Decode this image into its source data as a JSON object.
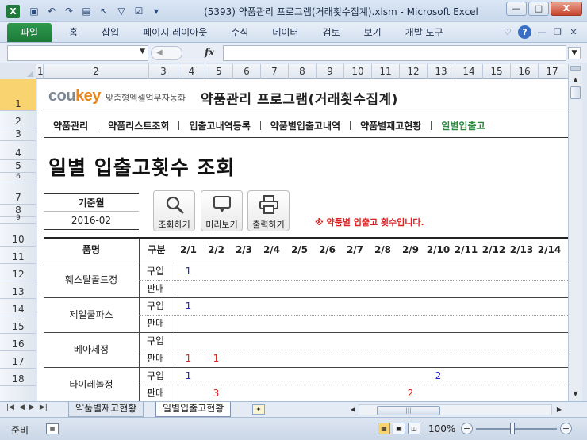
{
  "window": {
    "title": "(5393) 약품관리 프로그램(거래횟수집계).xlsm  -  Microsoft Excel",
    "app_icon": "X",
    "min_label": "—",
    "max_label": "□",
    "close_label": "X"
  },
  "ribbon": {
    "file_tab": "파일",
    "tabs": [
      "홈",
      "삽입",
      "페이지 레이아웃",
      "수식",
      "데이터",
      "검토",
      "보기",
      "개발 도구"
    ]
  },
  "formula_bar": {
    "name_box": "",
    "fx": "fx",
    "formula": ""
  },
  "columns": [
    "1",
    "2",
    "3",
    "4",
    "5",
    "6",
    "7",
    "8",
    "9",
    "10",
    "11",
    "12",
    "13",
    "14",
    "15",
    "16",
    "17"
  ],
  "rows": [
    "1",
    "2",
    "3",
    "4",
    "5",
    "6",
    "7",
    "8",
    "9",
    "10",
    "11",
    "12",
    "13",
    "14",
    "15",
    "16",
    "17",
    "18"
  ],
  "sheet": {
    "brand_logo_main": "cou",
    "brand_logo_accent": "key",
    "brand_tagline": "맞춤형엑셀업무자동화",
    "program_title": "약품관리 프로그램(거래횟수집계)",
    "menu": [
      "약품관리",
      "약품리스트조회",
      "입출고내역등록",
      "약품별입출고내역",
      "약품별재고현황",
      "일별입출고"
    ],
    "page_heading": "일별 입출고횟수 조회",
    "basis_label": "기준월",
    "basis_value": "2016-02",
    "buttons": {
      "search": "조회하기",
      "preview": "미리보기",
      "print": "출력하기"
    },
    "notice": "※ 약품별 입출고 횟수입니다.",
    "table": {
      "header_item": "품명",
      "header_type": "구분",
      "dates": [
        "2/1",
        "2/2",
        "2/3",
        "2/4",
        "2/5",
        "2/6",
        "2/7",
        "2/8",
        "2/9",
        "2/10",
        "2/11",
        "2/12",
        "2/13",
        "2/14"
      ],
      "items": [
        {
          "name": "훼스탈골드정",
          "rows": [
            {
              "type": "구입",
              "values": [
                "1",
                "",
                "",
                "",
                "",
                "",
                "",
                "",
                "",
                "",
                "",
                "",
                "",
                ""
              ]
            },
            {
              "type": "판매",
              "values": [
                "",
                "",
                "",
                "",
                "",
                "",
                "",
                "",
                "",
                "",
                "",
                "",
                "",
                ""
              ]
            }
          ]
        },
        {
          "name": "제일쿨파스",
          "rows": [
            {
              "type": "구입",
              "values": [
                "1",
                "",
                "",
                "",
                "",
                "",
                "",
                "",
                "",
                "",
                "",
                "",
                "",
                ""
              ]
            },
            {
              "type": "판매",
              "values": [
                "",
                "",
                "",
                "",
                "",
                "",
                "",
                "",
                "",
                "",
                "",
                "",
                "",
                ""
              ]
            }
          ]
        },
        {
          "name": "베아제정",
          "rows": [
            {
              "type": "구입",
              "values": [
                "",
                "",
                "",
                "",
                "",
                "",
                "",
                "",
                "",
                "",
                "",
                "",
                "",
                ""
              ]
            },
            {
              "type": "판매",
              "values": [
                "1",
                "1",
                "",
                "",
                "",
                "",
                "",
                "",
                "",
                "",
                "",
                "",
                "",
                ""
              ]
            }
          ]
        },
        {
          "name": "타이레놀정",
          "rows": [
            {
              "type": "구입",
              "values": [
                "1",
                "",
                "",
                "",
                "",
                "",
                "",
                "",
                "",
                "2",
                "",
                "",
                "",
                ""
              ]
            },
            {
              "type": "판매",
              "values": [
                "",
                "3",
                "",
                "",
                "",
                "",
                "",
                "",
                "2",
                "",
                "",
                "",
                "",
                ""
              ]
            }
          ]
        }
      ]
    }
  },
  "sheet_tabs": [
    "약품별재고현황",
    "일별입출고현황"
  ],
  "status": {
    "ready": "준비",
    "zoom": "100%"
  },
  "colors": {
    "purchase_value": "#2323c8",
    "sale_value": "#e02020",
    "active_menu": "#2b8a3e",
    "brand_accent": "#e8871b",
    "file_tab": "#1d7a38"
  }
}
